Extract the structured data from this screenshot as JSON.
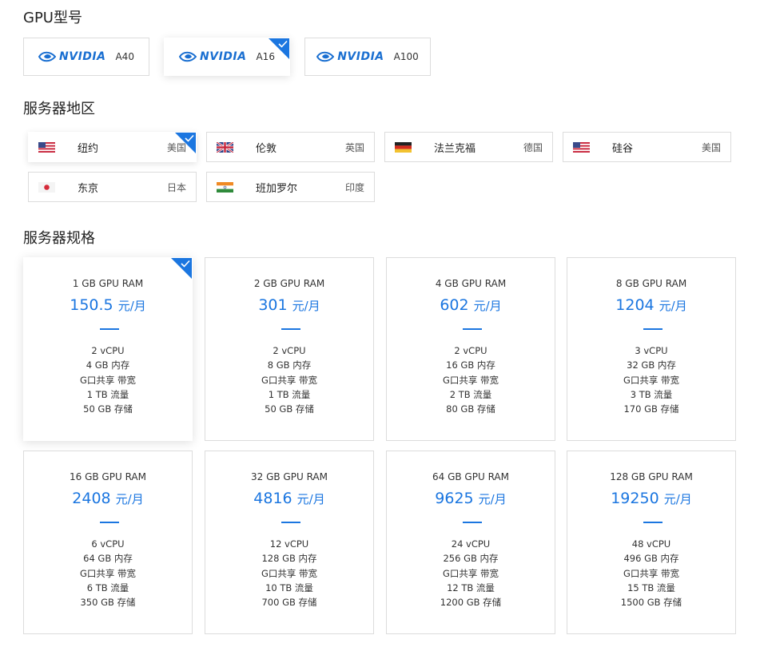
{
  "gpu_section": {
    "title": "GPU型号",
    "brand": "NVIDIA",
    "accent_color": "#1b76e0",
    "models": [
      {
        "name": "A40",
        "selected": false
      },
      {
        "name": "A16",
        "selected": true
      },
      {
        "name": "A100",
        "selected": false
      }
    ]
  },
  "region_section": {
    "title": "服务器地区",
    "regions": [
      {
        "city": "纽约",
        "country": "美国",
        "flag": "us-flag-icon",
        "selected": true
      },
      {
        "city": "伦敦",
        "country": "英国",
        "flag": "uk-flag-icon",
        "selected": false
      },
      {
        "city": "法兰克福",
        "country": "德国",
        "flag": "de-flag-icon",
        "selected": false
      },
      {
        "city": "硅谷",
        "country": "美国",
        "flag": "us-flag-icon",
        "selected": false
      },
      {
        "city": "东京",
        "country": "日本",
        "flag": "jp-flag-icon",
        "selected": false
      },
      {
        "city": "班加罗尔",
        "country": "印度",
        "flag": "in-flag-icon",
        "selected": false
      }
    ]
  },
  "spec_section": {
    "title": "服务器规格",
    "price_unit": "元/月",
    "plans": [
      {
        "ram": "1 GB GPU RAM",
        "price": "150.5",
        "vcpu": "2 vCPU",
        "memory": "4 GB 内存",
        "bandwidth": "G口共享 带宽",
        "traffic": "1 TB 流量",
        "storage": "50 GB 存储",
        "selected": true
      },
      {
        "ram": "2 GB GPU RAM",
        "price": "301",
        "vcpu": "2 vCPU",
        "memory": "8 GB 内存",
        "bandwidth": "G口共享 带宽",
        "traffic": "1 TB 流量",
        "storage": "50 GB 存储",
        "selected": false
      },
      {
        "ram": "4 GB GPU RAM",
        "price": "602",
        "vcpu": "2 vCPU",
        "memory": "16 GB 内存",
        "bandwidth": "G口共享 带宽",
        "traffic": "2 TB 流量",
        "storage": "80 GB 存储",
        "selected": false
      },
      {
        "ram": "8 GB GPU RAM",
        "price": "1204",
        "vcpu": "3 vCPU",
        "memory": "32 GB 内存",
        "bandwidth": "G口共享 带宽",
        "traffic": "3 TB 流量",
        "storage": "170 GB 存储",
        "selected": false
      },
      {
        "ram": "16 GB GPU RAM",
        "price": "2408",
        "vcpu": "6 vCPU",
        "memory": "64 GB 内存",
        "bandwidth": "G口共享 带宽",
        "traffic": "6 TB 流量",
        "storage": "350 GB 存储",
        "selected": false
      },
      {
        "ram": "32 GB GPU RAM",
        "price": "4816",
        "vcpu": "12 vCPU",
        "memory": "128 GB 内存",
        "bandwidth": "G口共享 带宽",
        "traffic": "10 TB 流量",
        "storage": "700 GB 存储",
        "selected": false
      },
      {
        "ram": "64 GB GPU RAM",
        "price": "9625",
        "vcpu": "24 vCPU",
        "memory": "256 GB 内存",
        "bandwidth": "G口共享 带宽",
        "traffic": "12 TB 流量",
        "storage": "1200 GB 存储",
        "selected": false
      },
      {
        "ram": "128 GB GPU RAM",
        "price": "19250",
        "vcpu": "48 vCPU",
        "memory": "496 GB 内存",
        "bandwidth": "G口共享 带宽",
        "traffic": "15 TB 流量",
        "storage": "1500 GB 存储",
        "selected": false
      }
    ]
  }
}
